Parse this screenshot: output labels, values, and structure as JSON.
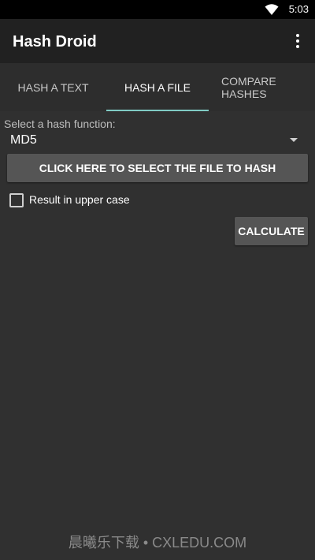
{
  "status_bar": {
    "time": "5:03"
  },
  "app_bar": {
    "title": "Hash Droid"
  },
  "tabs": [
    {
      "label": "HASH A TEXT",
      "selected": false
    },
    {
      "label": "HASH A FILE",
      "selected": true
    },
    {
      "label": "COMPARE\nHASHES",
      "selected": false
    }
  ],
  "hash_function": {
    "label": "Select a hash function:",
    "selected": "MD5"
  },
  "select_file_button": "CLICK HERE TO SELECT THE FILE TO HASH",
  "uppercase_option": {
    "label": "Result in upper case",
    "checked": false
  },
  "calculate_button": "CALCULATE",
  "watermark": "晨曦乐下载 • CXLEDU.COM",
  "colors": {
    "background": "#303030",
    "app_bar": "#212121",
    "tab_indicator": "#80cbc4",
    "button": "#555555"
  }
}
